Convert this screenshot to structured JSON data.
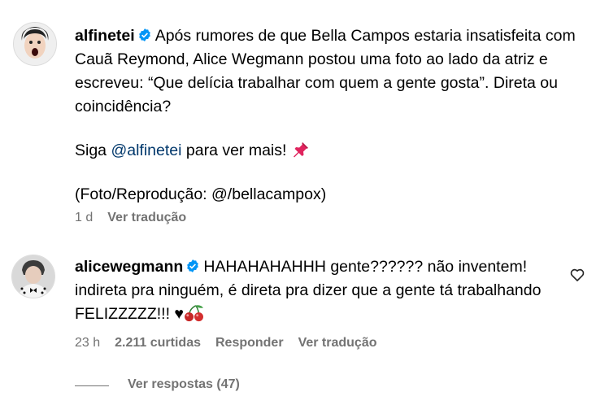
{
  "post": {
    "username": "alfinetei",
    "caption_text": "Após rumores de que Bella Campos estaria insatisfeita com Cauã Reymond, Alice Wegmann postou uma foto ao lado da atriz e escreveu: “Que delícia trabalhar com quem a gente gosta”. Direta ou coincidência?",
    "follow_prefix": "Siga ",
    "follow_mention": "@alfinetei",
    "follow_suffix": " para ver mais! ",
    "credit": "(Foto/Reprodução: @/bellacampox)",
    "time": "1 d",
    "translate_label": "Ver tradução"
  },
  "comment": {
    "username": "alicewegmann",
    "text": "HAHAHAHAHHH gente?????? não inventem! indireta pra ninguém, é direta pra dizer que a gente tá trabalhando FELIZZZZZ!!! ♥",
    "time": "23 h",
    "likes": "2.211 curtidas",
    "reply_label": "Responder",
    "translate_label": "Ver tradução"
  },
  "replies": {
    "label": "Ver respostas (47)"
  },
  "colors": {
    "verified": "#0095f6",
    "mention": "#00376b",
    "secondary_text": "#737373"
  }
}
